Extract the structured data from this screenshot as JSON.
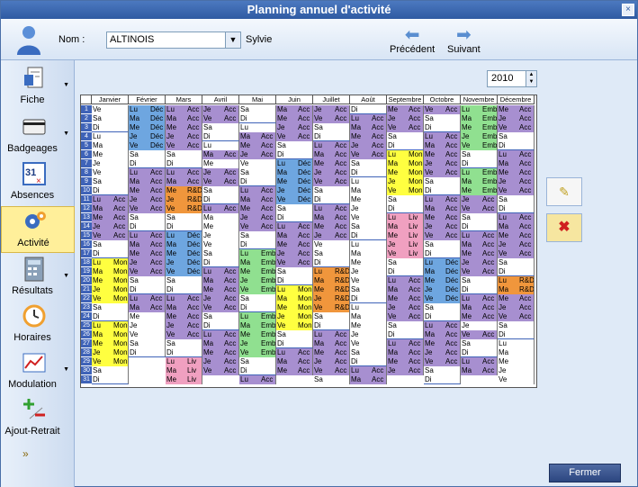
{
  "window": {
    "title": "Planning annuel d'activité",
    "close": "×"
  },
  "topbar": {
    "nom_label": "Nom :",
    "nom_value": "ALTINOIS",
    "prenom": "Sylvie",
    "prev_label": "Précédent",
    "next_label": "Suivant"
  },
  "sidebar": {
    "items": [
      {
        "label": "Fiche",
        "icon": "document-icon"
      },
      {
        "label": "Badgeages",
        "icon": "card-icon"
      },
      {
        "label": "Absences",
        "icon": "calendar-icon"
      },
      {
        "label": "Activité",
        "icon": "gears-icon"
      },
      {
        "label": "Résultats",
        "icon": "calculator-icon"
      },
      {
        "label": "Horaires",
        "icon": "clock-icon"
      },
      {
        "label": "Modulation",
        "icon": "chart-icon"
      },
      {
        "label": "Ajout-Retrait",
        "icon": "plus-minus-icon"
      }
    ]
  },
  "year": "2010",
  "months": [
    "Janvier",
    "Février",
    "Mars",
    "Avril",
    "Mai",
    "Juin",
    "Juillet",
    "Août",
    "Septembre",
    "Octobre",
    "Novembre",
    "Décembre"
  ],
  "colors": {
    "Acc": "#a78fd0",
    "Déc": "#6ea6e0",
    "R&D": "#f0963c",
    "Mon": "#ffff40",
    "Emb": "#90e090",
    "Liv": "#f0a0c0",
    "weekend": "#ffffff",
    "empty": "#ffffff"
  },
  "columns": [
    [
      "Ve",
      "Sa",
      "Di",
      "Lu",
      "Ma",
      "Me",
      "Je",
      "Ve",
      "Sa",
      "Di",
      "Lu Acc",
      "Ma Acc",
      "Me Acc",
      "Je Acc",
      "Ve Acc",
      "Sa",
      "Di",
      "Lu Mon",
      "Ma Mon",
      "Me Mon",
      "Je Mon",
      "Ve Mon",
      "Sa",
      "Di",
      "Lu Mon",
      "Ma Mon",
      "Me Mon",
      "Je Mon",
      "Ve Mon",
      "Sa",
      "Di"
    ],
    [
      "Lu Déc",
      "Ma Déc",
      "Me Déc",
      "Je Déc",
      "Ve Déc",
      "Sa",
      "Di",
      "Lu Acc",
      "Ma Acc",
      "Me Acc",
      "Je Acc",
      "Ve Acc",
      "Sa",
      "Di",
      "Lu Acc",
      "Ma Acc",
      "Me Acc",
      "Je Acc",
      "Ve Acc",
      "Sa",
      "Di",
      "Lu Acc",
      "Ma Acc",
      "Me",
      "Je",
      "Ve",
      "Sa",
      "Di"
    ],
    [
      "Lu Acc",
      "Ma Acc",
      "Me Acc",
      "Je Acc",
      "Ve Acc",
      "Sa",
      "Di",
      "Lu Acc",
      "Ma Acc",
      "Me R&D",
      "Je R&D",
      "Ve R&D",
      "Sa",
      "Di",
      "Lu Déc",
      "Ma Déc",
      "Me Déc",
      "Je Déc",
      "Ve Déc",
      "Sa",
      "Di",
      "Lu Acc",
      "Ma Acc",
      "Me Acc",
      "Je Acc",
      "Ve Acc",
      "Sa",
      "Di",
      "Lu Liv",
      "Ma Liv",
      "Me Liv"
    ],
    [
      "Je Acc",
      "Ve Acc",
      "Sa",
      "Di",
      "Lu",
      "Ma Acc",
      "Me",
      "Je Acc",
      "Ve Acc",
      "Sa",
      "Di",
      "Lu Acc",
      "Ma",
      "Me",
      "Je",
      "Ve",
      "Sa",
      "Di",
      "Lu Acc",
      "Ma Acc",
      "Me Acc",
      "Je Acc",
      "Ve Acc",
      "Sa",
      "Di",
      "Lu Acc",
      "Ma Acc",
      "Me Acc",
      "Je Acc",
      "Ve Acc"
    ],
    [
      "Sa",
      "Di",
      "Lu",
      "Ma Acc",
      "Me Acc",
      "Je Acc",
      "Ve",
      "Sa",
      "Di",
      "Lu Acc",
      "Ma Acc",
      "Me Acc",
      "Je Acc",
      "Ve Acc",
      "Sa",
      "Di",
      "Lu Emb",
      "Ma Emb",
      "Me Emb",
      "Je Emb",
      "Ve Emb",
      "Sa",
      "Di",
      "Lu Emb",
      "Ma Emb",
      "Me Emb",
      "Je Emb",
      "Ve Emb",
      "Sa",
      "Di",
      "Lu Acc"
    ],
    [
      "Ma Acc",
      "Me Acc",
      "Je Acc",
      "Ve Acc",
      "Sa",
      "Di",
      "Lu Déc",
      "Ma Déc",
      "Me Déc",
      "Je Déc",
      "Ve Déc",
      "Sa",
      "Di",
      "Lu Acc",
      "Ma Acc",
      "Me Acc",
      "Je Acc",
      "Ve Acc",
      "Sa",
      "Di",
      "Lu Mon",
      "Ma Mon",
      "Me Mon",
      "Je Mon",
      "Ve Mon",
      "Sa",
      "Di",
      "Lu Acc",
      "Ma Acc",
      "Me Acc"
    ],
    [
      "Je Acc",
      "Ve Acc",
      "Sa",
      "Di",
      "Lu Acc",
      "Ma Acc",
      "Me Acc",
      "Je Acc",
      "Ve Acc",
      "Sa",
      "Di",
      "Lu Acc",
      "Ma Acc",
      "Me Acc",
      "Je Acc",
      "Ve",
      "Sa",
      "Di",
      "Lu R&D",
      "Ma R&D",
      "Me R&D",
      "Je R&D",
      "Ve R&D",
      "Sa",
      "Di",
      "Lu Acc",
      "Ma Acc",
      "Me Acc",
      "Je Acc",
      "Ve Acc",
      "Sa"
    ],
    [
      "Di",
      "Lu Acc",
      "Ma Acc",
      "Me Acc",
      "Je Acc",
      "Ve Acc",
      "Sa",
      "Di",
      "Lu",
      "Ma",
      "Me",
      "Je",
      "Ve",
      "Sa",
      "Di",
      "Lu",
      "Ma",
      "Me",
      "Je",
      "Ve",
      "Sa",
      "Di",
      "Lu",
      "Ma",
      "Me",
      "Je",
      "Ve",
      "Sa",
      "Di",
      "Lu Acc",
      "Ma Acc"
    ],
    [
      "Me Acc",
      "Je Acc",
      "Ve Acc",
      "Sa",
      "Di",
      "Lu Mon",
      "Ma Mon",
      "Me Mon",
      "Je Mon",
      "Ve Mon",
      "Sa",
      "Di",
      "Lu Liv",
      "Ma Liv",
      "Me Liv",
      "Je Liv",
      "Ve Liv",
      "Sa",
      "Di",
      "Lu Acc",
      "Ma Acc",
      "Me Acc",
      "Je Acc",
      "Ve Acc",
      "Sa",
      "Di",
      "Lu Acc",
      "Ma Acc",
      "Me Acc",
      "Je Acc"
    ],
    [
      "Ve Acc",
      "Sa",
      "Di",
      "Lu Acc",
      "Ma Acc",
      "Me Acc",
      "Je Acc",
      "Ve Acc",
      "Sa",
      "Di",
      "Lu Acc",
      "Ma Acc",
      "Me Acc",
      "Je Acc",
      "Ve Acc",
      "Sa",
      "Di",
      "Lu Déc",
      "Ma Déc",
      "Me Déc",
      "Je Déc",
      "Ve Déc",
      "Sa",
      "Di",
      "Lu Acc",
      "Ma Acc",
      "Me Acc",
      "Je Acc",
      "Ve Acc",
      "Sa",
      "Di"
    ],
    [
      "Lu Emb",
      "Ma Emb",
      "Me Emb",
      "Je Emb",
      "Ve Emb",
      "Sa",
      "Di",
      "Lu Emb",
      "Ma Emb",
      "Me Emb",
      "Je Acc",
      "Ve Acc",
      "Sa",
      "Di",
      "Lu Acc",
      "Ma Acc",
      "Me Acc",
      "Je Acc",
      "Ve Acc",
      "Sa",
      "Di",
      "Lu Acc",
      "Ma Acc",
      "Me Acc",
      "Je",
      "Ve Acc",
      "Sa",
      "Di",
      "Lu Acc",
      "Ma Acc"
    ],
    [
      "Me Acc",
      "Je Acc",
      "Ve Acc",
      "Sa",
      "Di",
      "Lu Acc",
      "Ma Acc",
      "Me Acc",
      "Je Acc",
      "Ve Acc",
      "Sa",
      "Di",
      "Lu Acc",
      "Ma Acc",
      "Me Acc",
      "Je Acc",
      "Ve Acc",
      "Sa",
      "Di",
      "Lu R&D",
      "Ma R&D",
      "Me Acc",
      "Je Acc",
      "Ve Acc",
      "Sa",
      "Di",
      "Lu",
      "Ma",
      "Me",
      "Je",
      "Ve"
    ]
  ],
  "buttons": {
    "fermer": "Fermer",
    "edit": "✎",
    "delete": "✖"
  },
  "expand_icon": "»"
}
